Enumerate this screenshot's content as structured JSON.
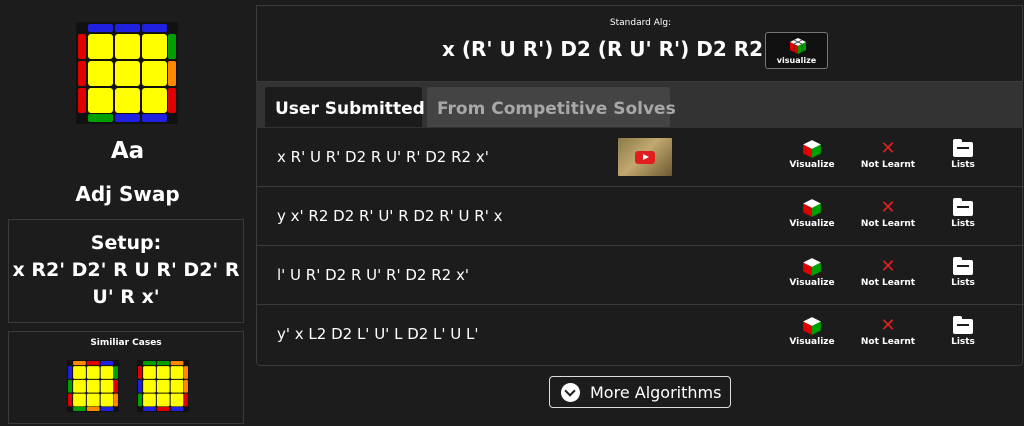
{
  "case": {
    "name": "Aa",
    "subtitle": "Adj Swap",
    "setup_label": "Setup:",
    "setup_alg": "x R2' D2' R U R' D2' R U' R x'",
    "similar_title": "Similiar Cases"
  },
  "standard": {
    "label": "Standard Alg:",
    "alg": "x (R' U R') D2 (R U' R') D2 R2 x'",
    "visualize_label": "visualize"
  },
  "tabs": [
    {
      "label": "User Submitted",
      "active": true
    },
    {
      "label": "From Competitive Solves",
      "active": false
    }
  ],
  "rows": [
    {
      "alg": "x R' U R' D2 R U' R' D2 R2 x'",
      "has_video": true,
      "visualize": "Visualize",
      "learn_status": "Not Learnt",
      "lists": "Lists"
    },
    {
      "alg": "y x' R2 D2 R' U' R D2 R' U R' x",
      "has_video": false,
      "visualize": "Visualize",
      "learn_status": "Not Learnt",
      "lists": "Lists"
    },
    {
      "alg": "l' U R' D2 R U' R' D2 R2 x'",
      "has_video": false,
      "visualize": "Visualize",
      "learn_status": "Not Learnt",
      "lists": "Lists"
    },
    {
      "alg": "y' x L2 D2 L' U' L D2 L' U L'",
      "has_video": false,
      "visualize": "Visualize",
      "learn_status": "Not Learnt",
      "lists": "Lists"
    }
  ],
  "more_button": "More Algorithms",
  "icons": {
    "case_cube": "cube-pll-diagram-icon",
    "visualize": "rubiks-cube-icon",
    "not_learnt": "red-x-icon",
    "lists": "folder-icon",
    "video": "youtube-play-icon",
    "more": "chevron-down-circle-icon"
  },
  "colors": {
    "background": "#1c1c1c",
    "yellow": "#ffff00",
    "green": "#00a000",
    "red": "#e00000",
    "blue": "#2020e0",
    "orange": "#ff8800",
    "x_red": "#e02020"
  }
}
